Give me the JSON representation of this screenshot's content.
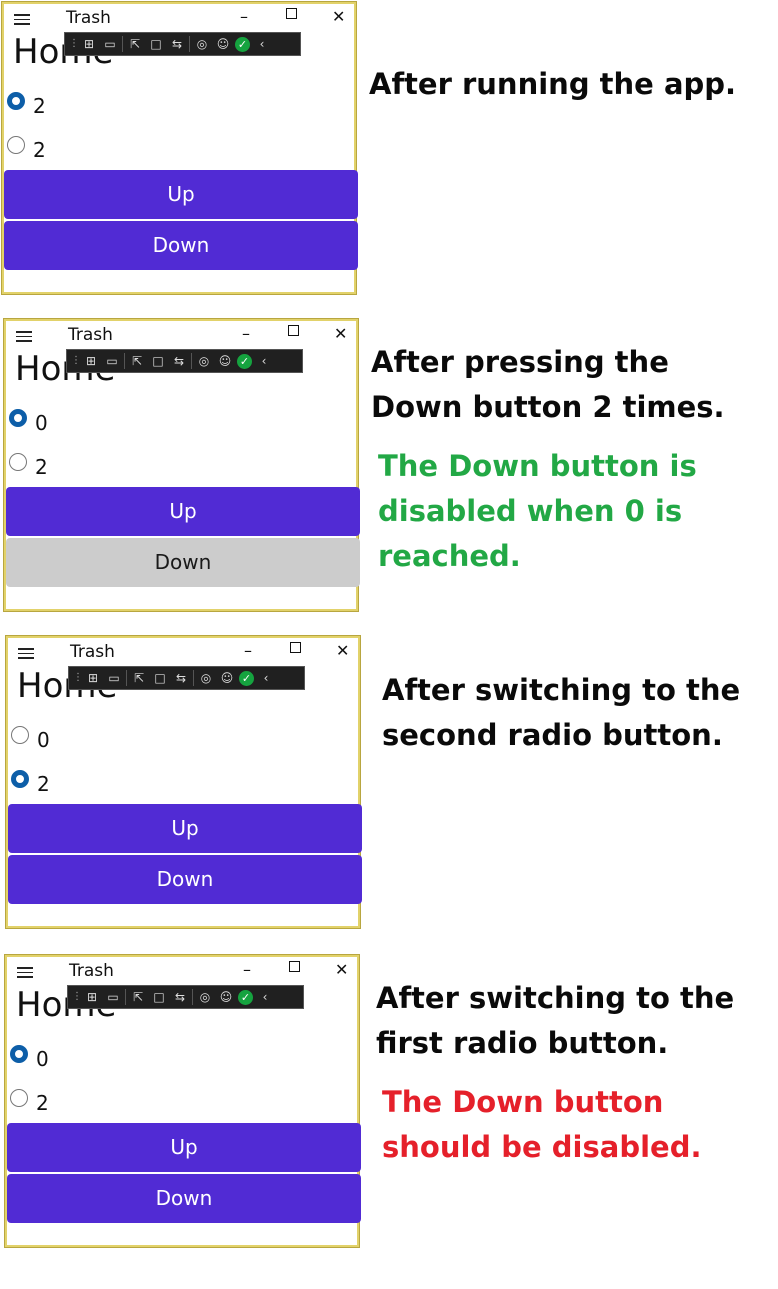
{
  "window": {
    "title": "Trash",
    "menu_glyph": "≡",
    "minimize_glyph": "–",
    "close_glyph": "✕",
    "page_heading": "Home",
    "toolbar_icons": [
      "grip-icon",
      "select-element-icon",
      "video-icon",
      "pointer-icon",
      "frame-icon",
      "hot-reload-icon",
      "accessibility-icon",
      "checkmark-icon",
      "chevron-left-icon"
    ]
  },
  "colors": {
    "accent": "#512bd4",
    "disabled": "#cccccc",
    "radio": "#0d5ea8",
    "green_note": "#22a845",
    "red_note": "#e5202a",
    "window_border": "#e2d26a"
  },
  "panels": [
    {
      "radios": [
        {
          "label": "2",
          "checked": true
        },
        {
          "label": "2",
          "checked": false
        }
      ],
      "buttons": [
        {
          "label": "Up",
          "disabled": false
        },
        {
          "label": "Down",
          "disabled": false
        }
      ],
      "caption": "After running the app.",
      "note": ""
    },
    {
      "radios": [
        {
          "label": "0",
          "checked": true
        },
        {
          "label": "2",
          "checked": false
        }
      ],
      "buttons": [
        {
          "label": "Up",
          "disabled": false
        },
        {
          "label": "Down",
          "disabled": true
        }
      ],
      "caption": "After pressing the\nDown button 2 times.",
      "note": "The Down button is\ndisabled when 0 is\nreached."
    },
    {
      "radios": [
        {
          "label": "0",
          "checked": false
        },
        {
          "label": "2",
          "checked": true
        }
      ],
      "buttons": [
        {
          "label": "Up",
          "disabled": false
        },
        {
          "label": "Down",
          "disabled": false
        }
      ],
      "caption": "After switching to the\nsecond radio button.",
      "note": ""
    },
    {
      "radios": [
        {
          "label": "0",
          "checked": true
        },
        {
          "label": "2",
          "checked": false
        }
      ],
      "buttons": [
        {
          "label": "Up",
          "disabled": false
        },
        {
          "label": "Down",
          "disabled": false
        }
      ],
      "caption": "After switching to the\nfirst radio button.",
      "note": "The Down button\nshould be disabled."
    }
  ]
}
